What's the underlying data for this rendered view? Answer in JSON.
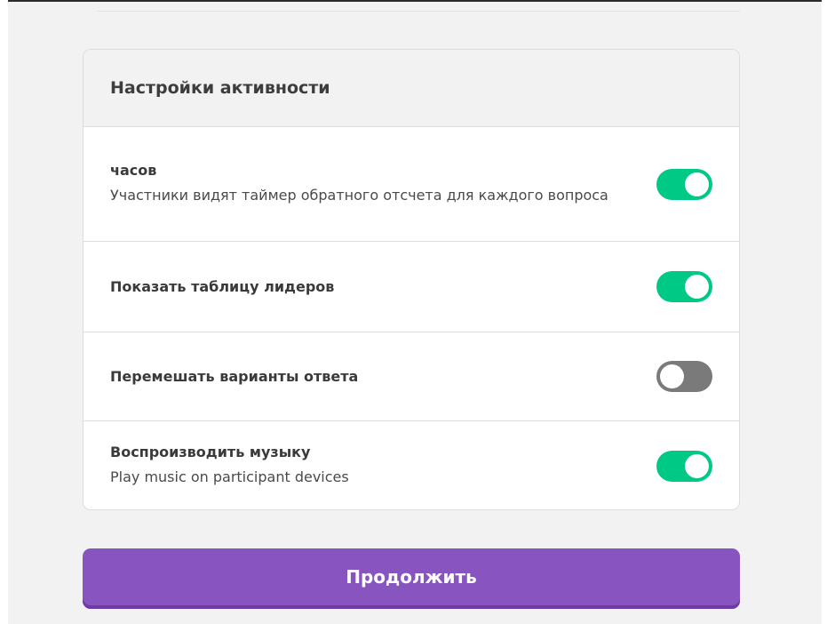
{
  "panel": {
    "title": "Настройки активности",
    "settings": [
      {
        "title": "часов",
        "description": "Участники видят таймер обратного отсчета для каждого вопроса",
        "enabled": true
      },
      {
        "title": "Показать таблицу лидеров",
        "description": "",
        "enabled": true
      },
      {
        "title": "Перемешать варианты ответа",
        "description": "",
        "enabled": false
      },
      {
        "title": "Воспроизводить музыку",
        "description": "Play music on participant devices",
        "enabled": true
      }
    ]
  },
  "actions": {
    "continue_label": "Продолжить"
  },
  "colors": {
    "toggle_on": "#00c985",
    "toggle_off": "#7a7a7a",
    "primary_button": "#8854c0",
    "background": "#f2f2f2"
  }
}
